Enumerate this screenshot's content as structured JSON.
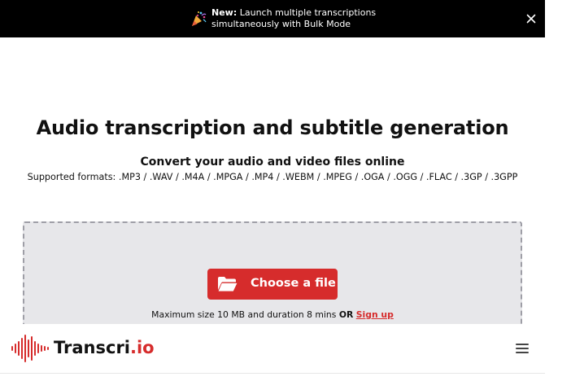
{
  "announcement": {
    "new_label": "New:",
    "line1": "Launch multiple transcriptions",
    "line2": "simultaneously with Bulk Mode",
    "icon": "party-popper-icon"
  },
  "hero": {
    "title": "Audio transcription and subtitle generation",
    "subtitle": "Convert your audio and video files online",
    "formats": "Supported formats: .MP3 / .WAV / .M4A / .MPGA / .MP4 / .WEBM / .MPEG / .OGA / .OGG / .FLAC / .3GP / .3GPP"
  },
  "upload": {
    "button_label": "Choose a file",
    "limits_text": "Maximum size 10 MB and duration 8 mins",
    "or_text": "OR",
    "signup_label": "Sign up"
  },
  "nav": {
    "logo_main": "Transcri",
    "logo_suffix": ".io",
    "menu_icon": "hamburger-menu-icon"
  },
  "colors": {
    "accent": "#d62c2c",
    "announcement_bg": "#000000",
    "dropzone_bg": "#e7e7ea"
  }
}
